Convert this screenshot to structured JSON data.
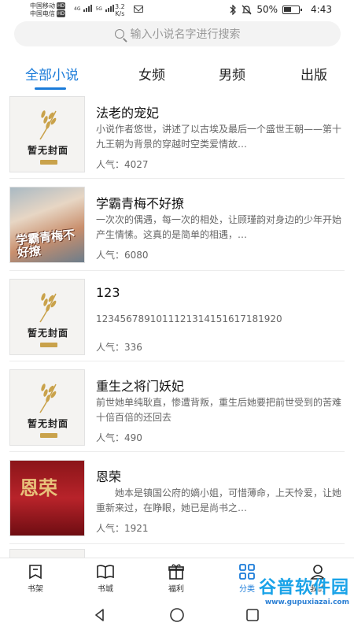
{
  "status_bar": {
    "carrier1": "中国移动",
    "carrier2": "中国电信",
    "hd": "HD",
    "network1": "4G",
    "network2": "5G",
    "speed_value": "3.2",
    "speed_unit": "K/s",
    "battery": "50%",
    "time": "4:43",
    "icons": [
      "bluetooth-icon",
      "mute-icon",
      "battery-icon",
      "mail-icon",
      "signal-icon"
    ]
  },
  "search": {
    "placeholder": "输入小说名字进行搜索"
  },
  "tabs": [
    {
      "label": "全部小说",
      "active": true
    },
    {
      "label": "女频",
      "active": false
    },
    {
      "label": "男频",
      "active": false
    },
    {
      "label": "出版",
      "active": false
    }
  ],
  "books": [
    {
      "title": "法老的宠妃",
      "desc": "小说作者悠世，讲述了以古埃及最后一个盛世王朝——第十九王朝为背景的穿越时空类爱情故…",
      "popularity": "人气：4027",
      "cover": "placeholder",
      "cover_text": "暂无封面"
    },
    {
      "title": "学霸青梅不好撩",
      "desc": "一次次的偶遇，每一次的相处，让顾瑾韵对身边的少年开始产生情愫。这真的是简单的相遇，…",
      "popularity": "人气：6080",
      "cover": "anime",
      "cover_text": "学霸青梅不好撩"
    },
    {
      "title": "123",
      "desc": "1234567891011121314151617181920",
      "popularity": "人气：336",
      "cover": "placeholder",
      "cover_text": "暂无封面"
    },
    {
      "title": "重生之将门妖妃",
      "desc": "前世她单纯耿直，惨遭背叛，重生后她要把前世受到的苦难十倍百倍的还回去",
      "popularity": "人气：490",
      "cover": "placeholder",
      "cover_text": "暂无封面"
    },
    {
      "title": "恩荣",
      "desc": "　　她本是镇国公府的嫡小姐，可惜薄命，上天怜爱，让她重新来过，在睁眼，她已是尚书之…",
      "popularity": "人气：1921",
      "cover": "red",
      "cover_text": "恩荣"
    }
  ],
  "bottom_nav": [
    {
      "label": "书架",
      "icon": "bookshelf-icon",
      "active": false
    },
    {
      "label": "书城",
      "icon": "book-open-icon",
      "active": false
    },
    {
      "label": "福利",
      "icon": "gift-icon",
      "active": false
    },
    {
      "label": "分类",
      "icon": "category-grid-icon",
      "active": true
    },
    {
      "label": "我的",
      "icon": "profile-icon",
      "active": false
    }
  ],
  "watermark": {
    "big": "谷普软件园",
    "small": "www.gupuxiazai.com"
  },
  "colors": {
    "accent": "#1a7bd9",
    "text": "#222222",
    "secondary_text": "#666666"
  }
}
